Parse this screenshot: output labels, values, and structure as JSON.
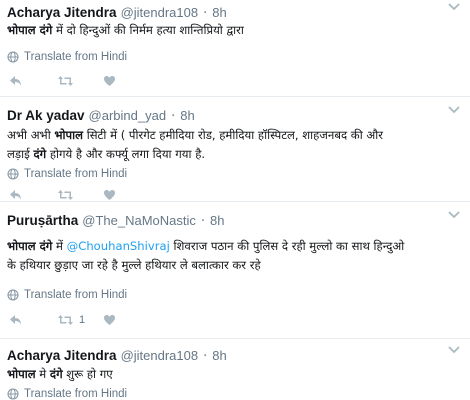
{
  "translate_label": "Translate from Hindi",
  "tweets": [
    {
      "name": "Acharya Jitendra",
      "handle": "@jitendra108",
      "time": "8h",
      "lines": [
        [
          {
            "b": "भोपाल दंगे"
          },
          {
            "t": " में दो हिन्दुओं की निर्मम हत्या शान्तिप्रियो द्वारा"
          }
        ]
      ],
      "retweets": "",
      "likes": ""
    },
    {
      "name": "Dr Ak yadav",
      "handle": "@arbind_yad",
      "time": "8h",
      "lines": [
        [
          {
            "t": "अभी अभी "
          },
          {
            "b": "भोपाल"
          },
          {
            "t": " सिटी में ( पीरगेट हमीदिया रोड, हमीदिया हॉस्पिटल, शाहजनबद की और"
          }
        ],
        [
          {
            "t": "लड़ाई "
          },
          {
            "b": "दंगे"
          },
          {
            "t": " होगये है और कर्फ्यू लगा दिया गया है."
          }
        ]
      ],
      "retweets": "",
      "likes": ""
    },
    {
      "name": "Puruṣārtha",
      "handle": "@The_NaMoNastic",
      "time": "8h",
      "lines": [
        [
          {
            "b": "भोपाल दंगे"
          },
          {
            "t": " में "
          },
          {
            "m": "@ChouhanShivraj"
          },
          {
            "t": " शिवराज पठान की पुलिस दे रही मुल्लो का साथ हिन्दुओ"
          }
        ],
        [
          {
            "t": "के हथियार छुड़ाए जा रहे है मुल्ले हथियार ले बलात्कार कर रहे"
          }
        ]
      ],
      "retweets": "1",
      "likes": ""
    },
    {
      "name": "Acharya Jitendra",
      "handle": "@jitendra108",
      "time": "8h",
      "lines": [
        [
          {
            "b": "भोपाल"
          },
          {
            "t": " मे "
          },
          {
            "b": "दंगे"
          },
          {
            "t": " शुरू हो गए"
          }
        ]
      ],
      "retweets": "",
      "likes": ""
    }
  ]
}
